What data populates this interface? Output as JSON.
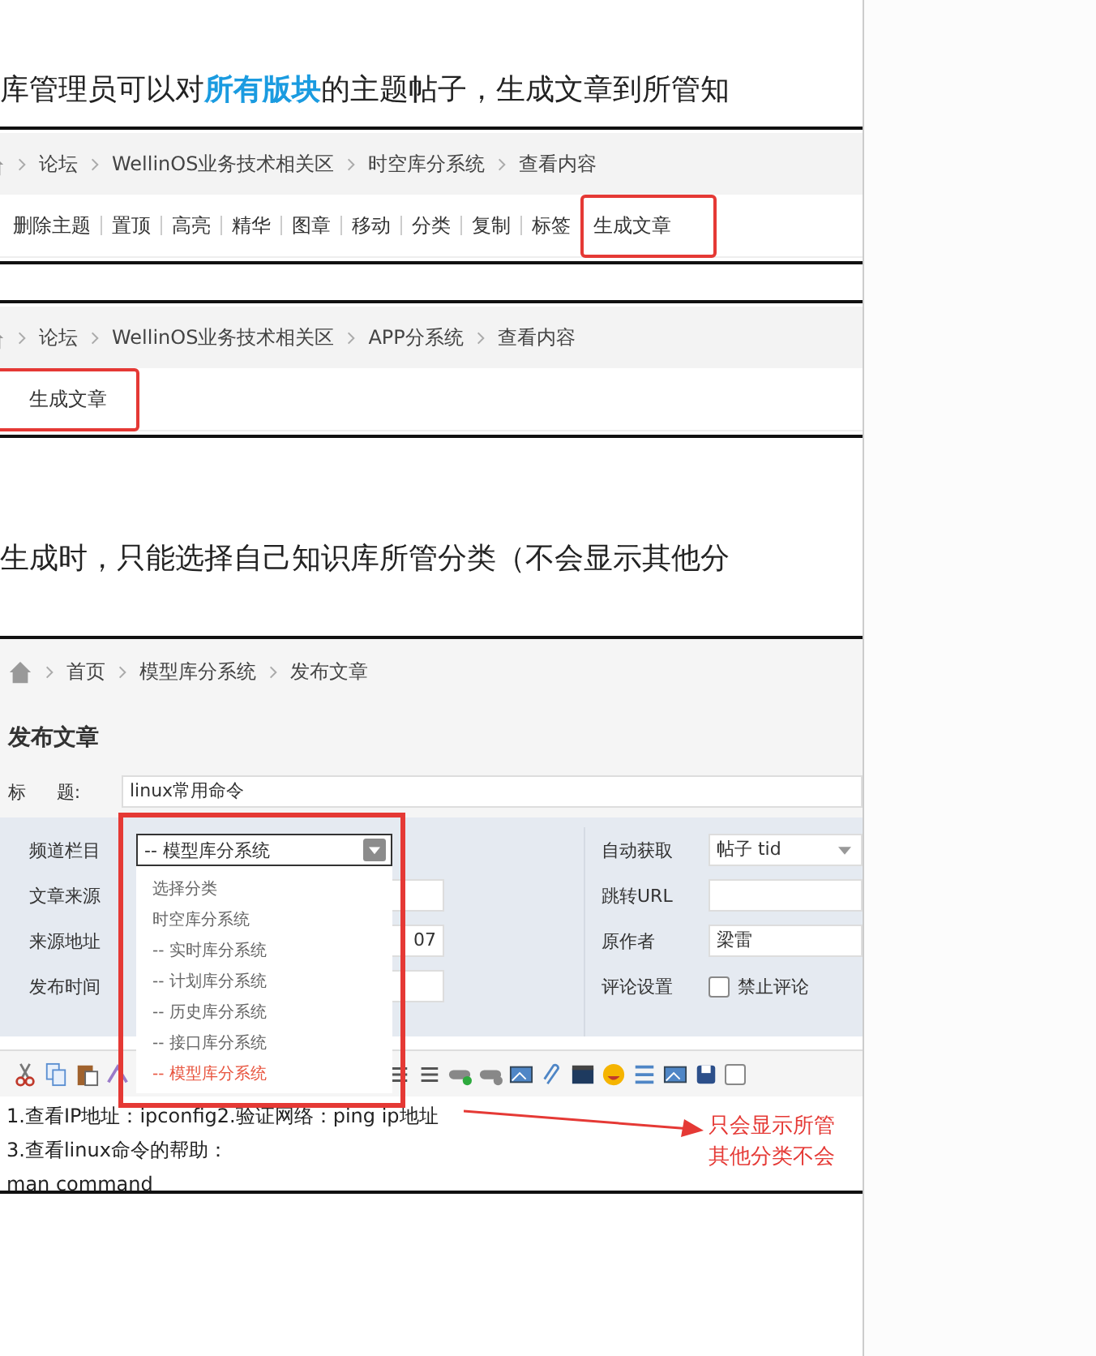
{
  "intro_text": "库管理员可以对**所有版块**的主题帖子，生成文章到所管知",
  "forum_screens": [
    {
      "breadcrumb": [
        "论坛",
        "WellinOS业务技术相关区",
        "时空库分系统",
        "查看内容"
      ],
      "actions": [
        {
          "label": "删除主题",
          "highlighted": false
        },
        {
          "label": "置顶",
          "highlighted": false
        },
        {
          "label": "高亮",
          "highlighted": false
        },
        {
          "label": "精华",
          "highlighted": false
        },
        {
          "label": "图章",
          "highlighted": false
        },
        {
          "label": "移动",
          "highlighted": false
        },
        {
          "label": "分类",
          "highlighted": false
        },
        {
          "label": "复制",
          "highlighted": false
        },
        {
          "label": "标签",
          "highlighted": false
        },
        {
          "label": "生成文章",
          "highlighted": true
        }
      ]
    },
    {
      "breadcrumb": [
        "论坛",
        "WellinOS业务技术相关区",
        "APP分系统",
        "查看内容"
      ],
      "actions": [
        {
          "label": "生成文章",
          "highlighted": true
        }
      ]
    }
  ],
  "note_text": "生成时，只能选择自己知识库所管分类（不会显示其他分",
  "publish_screen": {
    "breadcrumb": [
      "首页",
      "模型库分系统",
      "发布文章"
    ],
    "heading": "发布文章",
    "title_label": "标 题:",
    "title_value": "linux常用命令",
    "left_fields": [
      {
        "label": "频道栏目"
      },
      {
        "label": "文章来源"
      },
      {
        "label": "来源地址",
        "value": "07"
      },
      {
        "label": "发布时间"
      }
    ],
    "category_dropdown": {
      "value": "-- 模型库分系统",
      "options": [
        {
          "label": "选择分类",
          "selected": false
        },
        {
          "label": "时空库分系统",
          "selected": false
        },
        {
          "label": "-- 实时库分系统",
          "selected": false
        },
        {
          "label": "-- 计划库分系统",
          "selected": false
        },
        {
          "label": "-- 历史库分系统",
          "selected": false
        },
        {
          "label": "-- 接口库分系统",
          "selected": false
        },
        {
          "label": "-- 模型库分系统",
          "selected": true
        }
      ]
    },
    "right_fields": [
      {
        "label": "自动获取",
        "kind": "select",
        "value": "帖子 tid"
      },
      {
        "label": "跳转URL",
        "kind": "input"
      },
      {
        "label": "原作者",
        "kind": "input",
        "value": "梁雷"
      },
      {
        "label": "评论设置",
        "kind": "checkbox",
        "checked": false,
        "text": "禁止评论"
      }
    ],
    "editor_toolbar_checkbox": {
      "checked": false
    },
    "editor_lines": [
      "1.查看IP地址：ipconfig2.验证网络：ping ip地址",
      "3.查看linux命令的帮助：",
      "man command"
    ],
    "annotation": [
      "只会显示所管",
      "其他分类不会"
    ]
  }
}
